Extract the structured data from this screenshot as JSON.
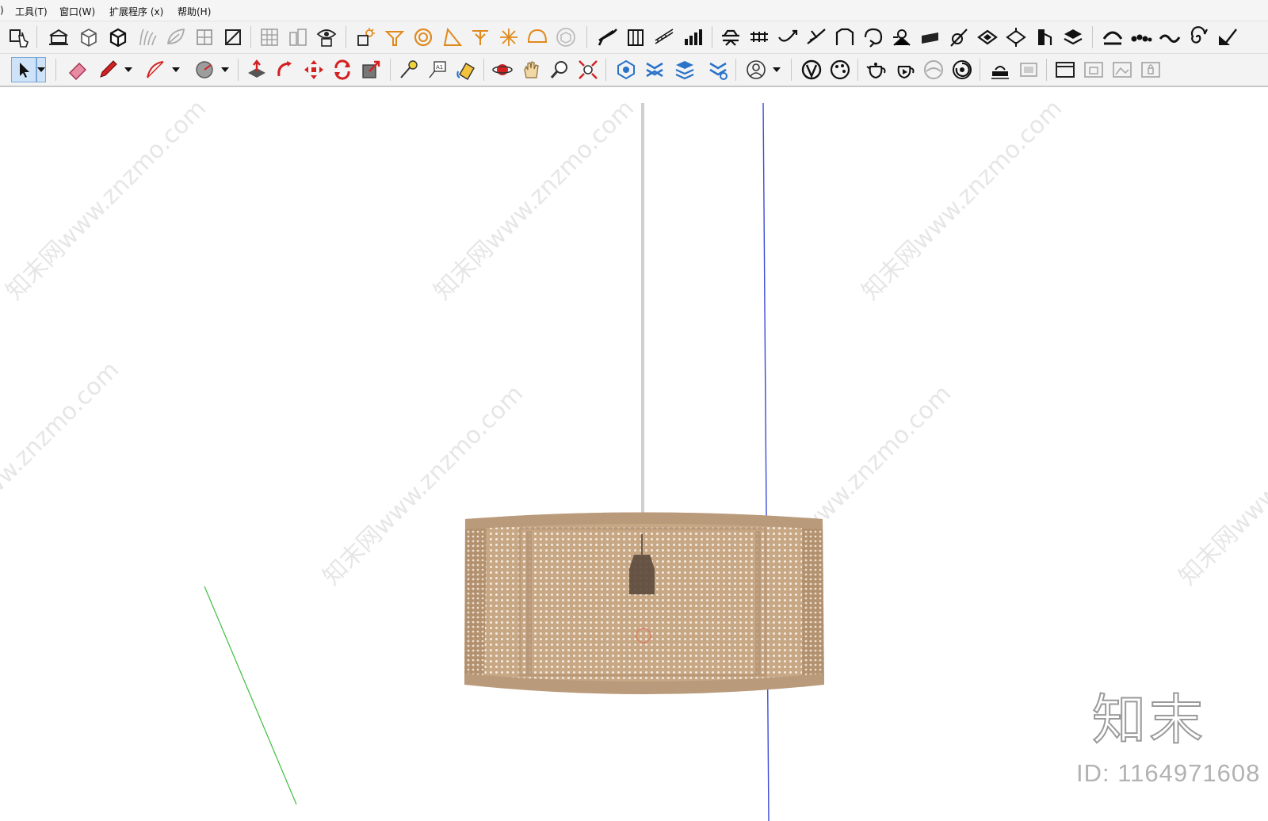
{
  "menubar": {
    "items": [
      {
        "label": ")"
      },
      {
        "label": "工具(T)"
      },
      {
        "label": "窗口(W)"
      },
      {
        "label": "扩展程序 (x)"
      },
      {
        "label": "帮助(H)"
      }
    ]
  },
  "watermark": {
    "text": "知末网www.znzmo.com",
    "logo": "知末",
    "id_label": "ID: 1164971608"
  },
  "colors": {
    "toolbar_bg": "#f3f3f3",
    "accent_red": "#d32020",
    "accent_orange": "#e08a1e",
    "accent_blue": "#2a73c9",
    "rattan": "#c8a987",
    "axis_blue": "#3b4bd6",
    "axis_green": "#3fbf3f"
  },
  "tools": {
    "row1": [
      "components-icon",
      "warehouse-icon",
      "box-icon",
      "box-3d-icon",
      "grass-icon",
      "leaf-icon",
      "window-icon",
      "panel-icon",
      "grid-icon",
      "tower-icon",
      "eye-icon",
      "shadow-icon",
      "lamp-icon",
      "target-icon",
      "triangle-icon",
      "spot-icon",
      "spark-icon",
      "dome-icon",
      "cube-icon",
      "stair-icon",
      "column-icon",
      "ramp-icon",
      "bars-icon",
      "sofa-icon",
      "rail-icon",
      "curve-icon",
      "arrow-icon",
      "gate-icon",
      "rope-icon",
      "pin-icon",
      "slab-icon",
      "wand-icon",
      "diamond-icon",
      "diamond-alt-icon",
      "chair-icon",
      "layers-icon",
      "arc-icon",
      "dots-icon",
      "wave-icon",
      "spiral-icon",
      "brush-icon"
    ],
    "row2": [
      "select-icon",
      "eraser-icon",
      "pencil-icon",
      "arc-tool-icon",
      "circle-tool-icon",
      "push-pull-icon",
      "follow-me-icon",
      "move-icon",
      "rotate-icon",
      "scale-icon",
      "tape-icon",
      "text-icon",
      "paint-icon",
      "orbit-icon",
      "pan-icon",
      "zoom-icon",
      "zoom-extents-icon",
      "section-icon",
      "layers-blue-icon",
      "stack-icon",
      "settings-blue-icon",
      "user-icon",
      "render-icon",
      "palette-icon",
      "teapot-icon",
      "teapot-play-icon",
      "sphere-icon",
      "refresh-icon",
      "scene-icon",
      "frame-icon",
      "window-1-icon",
      "window-2-icon",
      "window-3-icon",
      "window-4-icon"
    ]
  }
}
